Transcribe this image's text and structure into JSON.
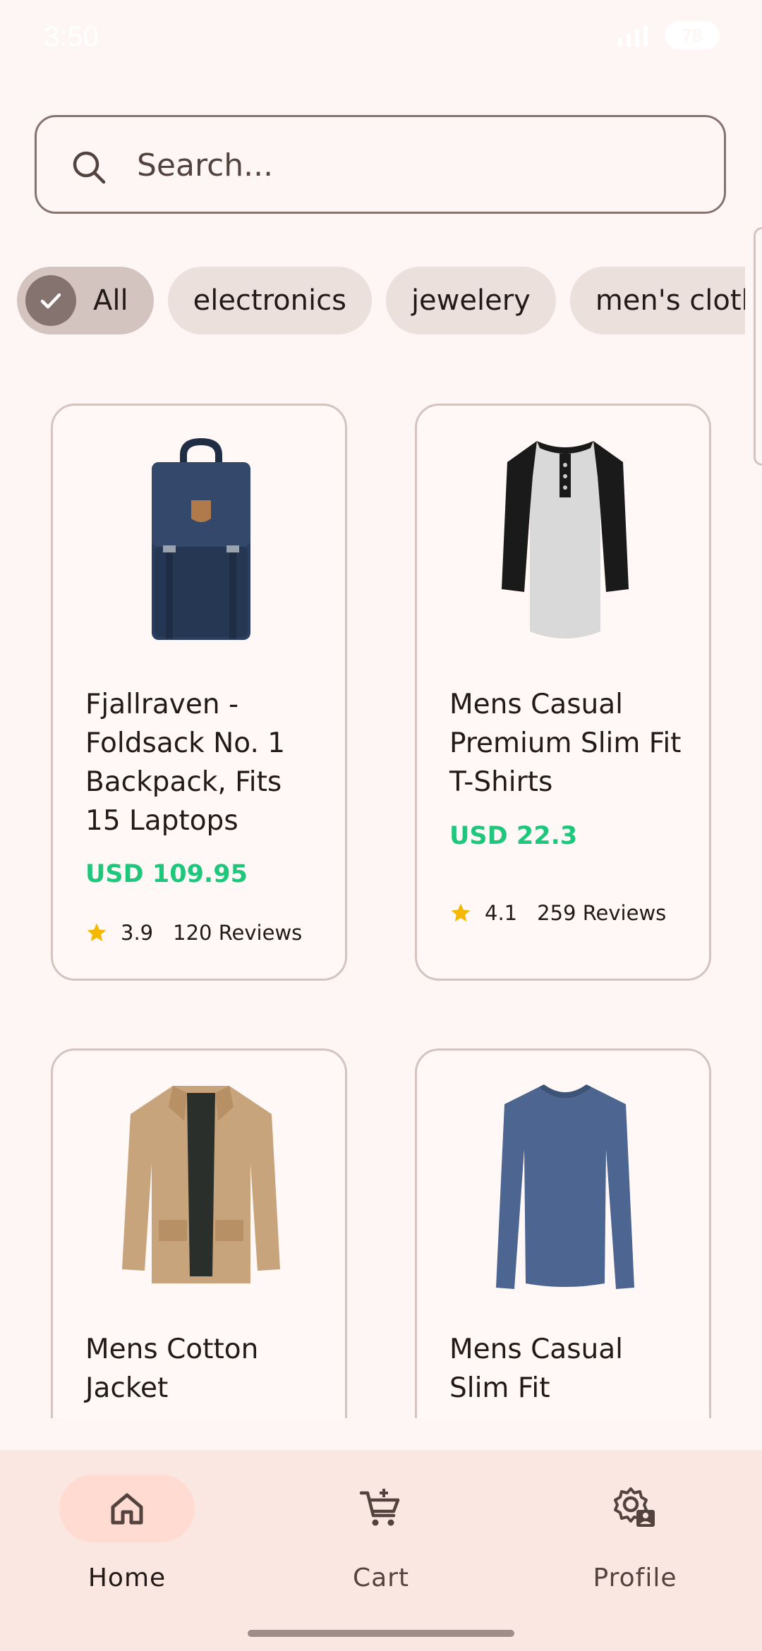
{
  "status_bar": {
    "time": "3:50",
    "battery": "78"
  },
  "search": {
    "placeholder": "Search..."
  },
  "categories": {
    "items": [
      "All",
      "electronics",
      "jewelery",
      "men's clothing"
    ],
    "selected": "All"
  },
  "products": [
    {
      "title": "Fjallraven - Foldsack No. 1 Backpack, Fits 15 Laptops",
      "price": "USD 109.95",
      "rating": "3.9",
      "reviews": "120 Reviews",
      "image": "backpack"
    },
    {
      "title": "Mens Casual Premium Slim Fit T-Shirts",
      "price": "USD 22.3",
      "rating": "4.1",
      "reviews": "259 Reviews",
      "image": "raglan-shirt"
    },
    {
      "title": "Mens Cotton Jacket",
      "image": "jacket"
    },
    {
      "title": "Mens Casual Slim Fit",
      "image": "long-sleeve-shirt"
    }
  ],
  "bottom_nav": {
    "items": [
      {
        "label": "Home",
        "icon": "home-icon",
        "active": true
      },
      {
        "label": "Cart",
        "icon": "cart-icon",
        "active": false
      },
      {
        "label": "Profile",
        "icon": "profile-settings-icon",
        "active": false
      }
    ]
  },
  "colors": {
    "background": "#fdf6f4",
    "price": "#1ec77c",
    "star": "#f5b800",
    "nav_background": "#fbe7e2",
    "nav_active_pill": "#ffdbd1"
  }
}
